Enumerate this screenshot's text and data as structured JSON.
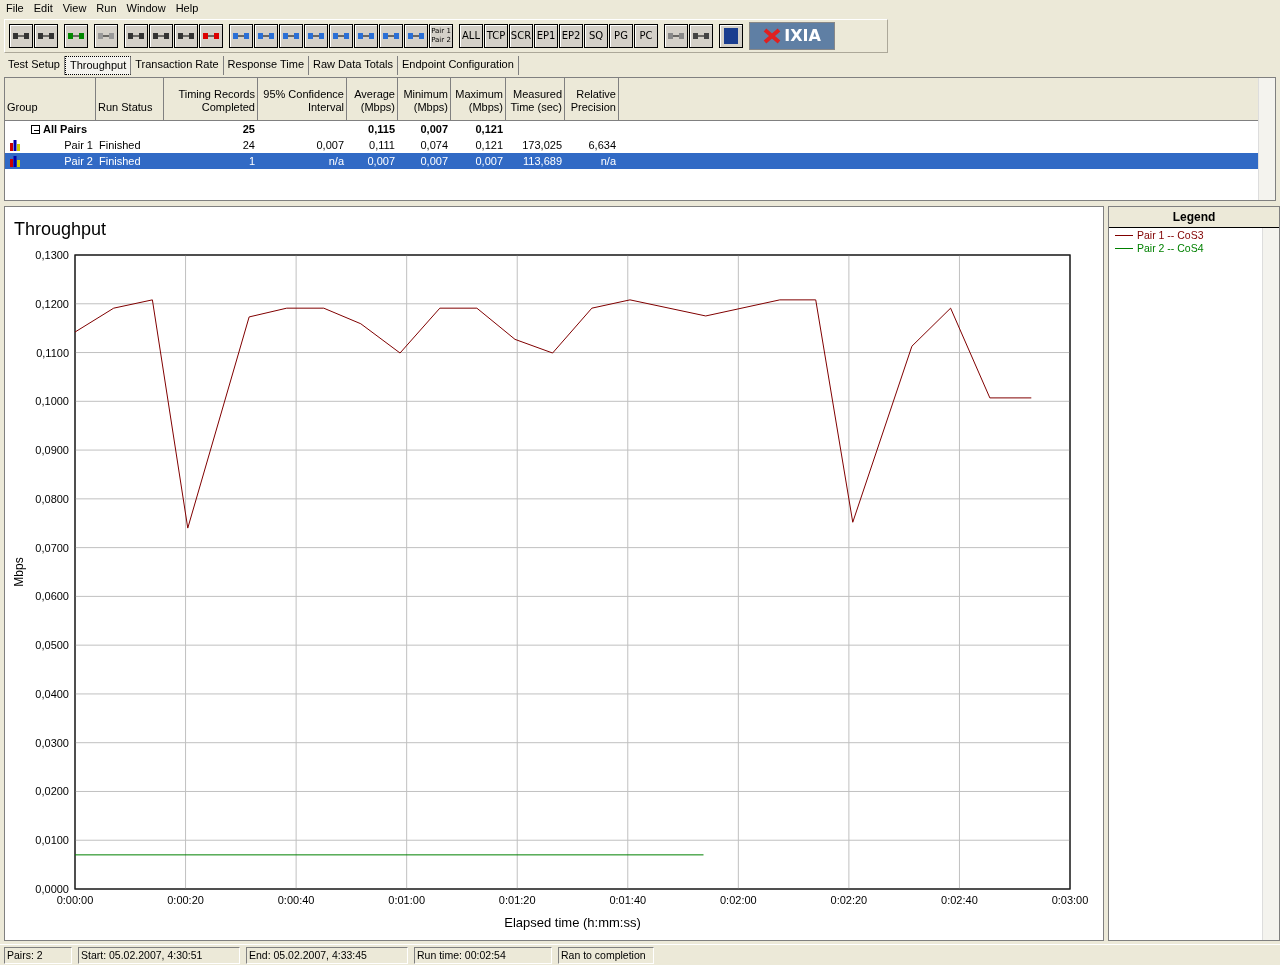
{
  "menu": [
    "File",
    "Edit",
    "View",
    "Run",
    "Window",
    "Help"
  ],
  "toolbar": {
    "pair_button": [
      "Pair 1",
      "Pair 2"
    ],
    "filter_buttons": [
      "ALL",
      "TCP",
      "SCR",
      "EP1",
      "EP2",
      "SQ",
      "PG",
      "PC"
    ],
    "logo": "IXIA"
  },
  "tabs": [
    {
      "label": "Test Setup",
      "selected": false
    },
    {
      "label": "Throughput",
      "selected": true
    },
    {
      "label": "Transaction Rate",
      "selected": false
    },
    {
      "label": "Response Time",
      "selected": false
    },
    {
      "label": "Raw Data Totals",
      "selected": false
    },
    {
      "label": "Endpoint Configuration",
      "selected": false
    }
  ],
  "table": {
    "columns": [
      "Group",
      "Run Status",
      "Timing Records\nCompleted",
      "95% Confidence\nInterval",
      "Average\n(Mbps)",
      "Minimum\n(Mbps)",
      "Maximum\n(Mbps)",
      "Measured\nTime (sec)",
      "Relative\nPrecision"
    ],
    "rows": [
      {
        "kind": "group",
        "expanded": true,
        "selected": false,
        "cells": [
          "All Pairs",
          "",
          "25",
          "",
          "0,115",
          "0,007",
          "0,121",
          "",
          ""
        ]
      },
      {
        "kind": "pair",
        "selected": false,
        "cells": [
          "Pair 1",
          "Finished",
          "24",
          "0,007",
          "0,111",
          "0,074",
          "0,121",
          "173,025",
          "6,634"
        ]
      },
      {
        "kind": "pair",
        "selected": true,
        "cells": [
          "Pair 2",
          "Finished",
          "1",
          "n/a",
          "0,007",
          "0,007",
          "0,007",
          "113,689",
          "n/a"
        ]
      }
    ]
  },
  "chart": {
    "title": "Throughput",
    "chart_data": {
      "type": "line",
      "grid": true,
      "xlabel": "Elapsed time (h:mm:ss)",
      "ylabel": "Mbps",
      "xlim": [
        0,
        180
      ],
      "ylim": [
        0,
        0.13
      ],
      "xticks": [
        {
          "value": 0,
          "label": "0:00:00"
        },
        {
          "value": 20,
          "label": "0:00:20"
        },
        {
          "value": 40,
          "label": "0:00:40"
        },
        {
          "value": 60,
          "label": "0:01:00"
        },
        {
          "value": 80,
          "label": "0:01:20"
        },
        {
          "value": 100,
          "label": "0:01:40"
        },
        {
          "value": 120,
          "label": "0:02:00"
        },
        {
          "value": 140,
          "label": "0:02:20"
        },
        {
          "value": 160,
          "label": "0:02:40"
        },
        {
          "value": 180,
          "label": "0:03:00"
        }
      ],
      "yticks": [
        {
          "value": 0,
          "label": "0,0000"
        },
        {
          "value": 0.01,
          "label": "0,0100"
        },
        {
          "value": 0.02,
          "label": "0,0200"
        },
        {
          "value": 0.03,
          "label": "0,0300"
        },
        {
          "value": 0.04,
          "label": "0,0400"
        },
        {
          "value": 0.05,
          "label": "0,0500"
        },
        {
          "value": 0.06,
          "label": "0,0600"
        },
        {
          "value": 0.07,
          "label": "0,0700"
        },
        {
          "value": 0.08,
          "label": "0,0800"
        },
        {
          "value": 0.09,
          "label": "0,0900"
        },
        {
          "value": 0.1,
          "label": "0,1000"
        },
        {
          "value": 0.11,
          "label": "0,1100"
        },
        {
          "value": 0.12,
          "label": "0,1200"
        },
        {
          "value": 0.13,
          "label": "0,1300"
        }
      ],
      "series": [
        {
          "name": "Pair 1 -- CoS3",
          "color": "#800000",
          "x": [
            0,
            7,
            14,
            20.4,
            31.5,
            38.3,
            45,
            51.7,
            58.8,
            66,
            72.7,
            79.6,
            86.4,
            93.5,
            100.4,
            114.1,
            127.5,
            134,
            140.7,
            151.4,
            158.4,
            165.5,
            173
          ],
          "values": [
            0.1142,
            0.1191,
            0.1208,
            0.074,
            0.1173,
            0.1191,
            0.1191,
            0.1159,
            0.1099,
            0.1191,
            0.1191,
            0.1127,
            0.1099,
            0.1191,
            0.1208,
            0.1175,
            0.1208,
            0.1208,
            0.0752,
            0.1113,
            0.1191,
            0.1007,
            0.1007
          ]
        },
        {
          "name": "Pair 2 -- CoS4",
          "color": "#008000",
          "x": [
            0,
            113.7
          ],
          "values": [
            0.007,
            0.007
          ]
        }
      ]
    }
  },
  "legend": {
    "title": "Legend"
  },
  "status_bar": [
    "Pairs: 2",
    "Start: 05.02.2007, 4:30:51",
    "End: 05.02.2007, 4:33:45",
    "Run time: 00:02:54",
    "Ran to completion"
  ]
}
